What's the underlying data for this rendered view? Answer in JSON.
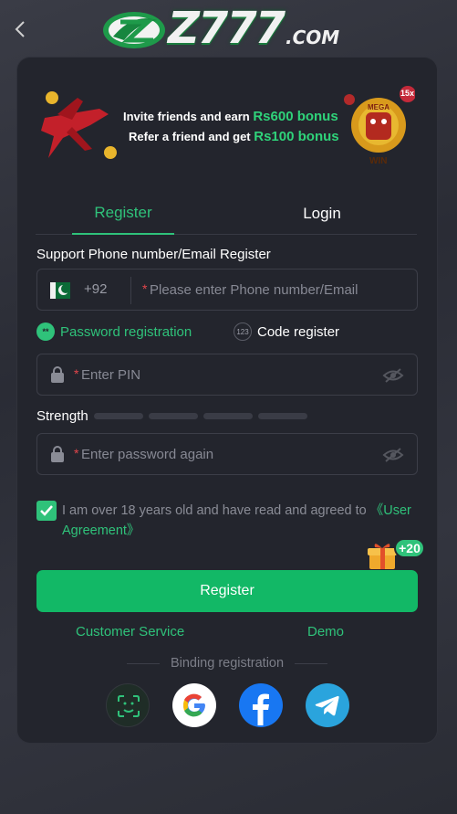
{
  "header": {
    "back_label": "‹",
    "logo_text": "Z777",
    "logo_suffix": ".COM"
  },
  "banner": {
    "line1_prefix": "Invite friends and earn ",
    "line1_amount": "Rs600 bonus",
    "line2_prefix": "Refer a friend and get ",
    "line2_amount": "Rs100 bonus",
    "badge_15x": "15x",
    "mega_label": "MEGA",
    "win_label": "WIN"
  },
  "tabs": [
    {
      "label": "Register",
      "active": true
    },
    {
      "label": "Login",
      "active": false
    }
  ],
  "form": {
    "section_title": "Support Phone number/Email Register",
    "dial_code": "+92",
    "phone_placeholder": "Please enter Phone number/Email",
    "mode_password_label": "Password registration",
    "mode_password_icon": "**",
    "mode_code_label": "Code register",
    "mode_code_icon": "123",
    "pin_placeholder": "Enter PIN",
    "strength_label": "Strength",
    "confirm_placeholder": "Enter password again",
    "agree_text": "I am over 18 years old and have read and agreed to ",
    "agree_link": "《User Agreement》",
    "agree_checked": true,
    "bonus_badge": "+20",
    "register_button": "Register"
  },
  "links": {
    "customer_service": "Customer Service",
    "demo": "Demo"
  },
  "binding": {
    "label": "Binding registration",
    "providers": [
      "face-id",
      "google",
      "facebook",
      "telegram"
    ]
  },
  "colors": {
    "accent": "#2fc27a",
    "button": "#12b866",
    "background": "#2b2d36",
    "card": "#23252d",
    "required": "#e4464b"
  }
}
